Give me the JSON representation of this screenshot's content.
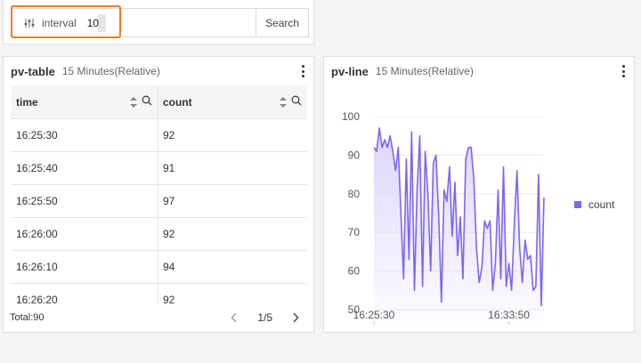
{
  "filter": {
    "variable_label": "interval",
    "variable_value": "10",
    "search_label": "Search"
  },
  "table_panel": {
    "title": "pv-table",
    "subtitle": "15 Minutes(Relative)",
    "columns": [
      "time",
      "count"
    ],
    "rows": [
      [
        "16:25:30",
        "92"
      ],
      [
        "16:25:40",
        "91"
      ],
      [
        "16:25:50",
        "97"
      ],
      [
        "16:26:00",
        "92"
      ],
      [
        "16:26:10",
        "94"
      ],
      [
        "16:26:20",
        "92"
      ]
    ],
    "total": "Total:90",
    "page": "1/5"
  },
  "chart_panel": {
    "title": "pv-line",
    "subtitle": "15 Minutes(Relative)",
    "colors": {
      "line": "#7b68ee",
      "area": "#d8d2fb"
    }
  },
  "chart_data": {
    "type": "area",
    "series": [
      {
        "name": "count",
        "values": [
          92,
          91,
          97,
          92,
          94,
          92,
          95,
          91,
          86,
          92,
          75,
          58,
          89,
          63,
          96,
          55,
          81,
          95,
          56,
          91,
          80,
          60,
          88,
          90,
          74,
          52,
          81,
          78,
          87,
          69,
          83,
          64,
          74,
          58,
          89,
          92,
          92,
          84,
          66,
          57,
          61,
          73,
          71,
          73,
          55,
          62,
          81,
          58,
          87,
          56,
          62,
          55,
          72,
          86,
          66,
          57,
          68,
          63,
          64,
          55,
          56,
          85,
          51,
          79
        ]
      }
    ],
    "x_tick_labels": [
      "16:25:30",
      "16:33:50"
    ],
    "x_tick_index": [
      0,
      50
    ],
    "y_ticks": [
      50,
      60,
      70,
      80,
      90,
      100
    ],
    "ylim": [
      47,
      103
    ],
    "grid": true,
    "legend_position": "right"
  }
}
